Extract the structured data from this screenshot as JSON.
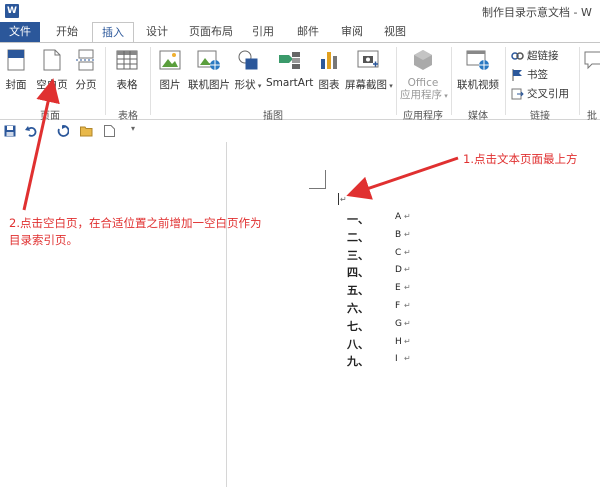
{
  "window": {
    "title": "制作目录示意文档 - W",
    "app_icon": "W"
  },
  "tabs": [
    {
      "label": "文件"
    },
    {
      "label": "开始"
    },
    {
      "label": "插入"
    },
    {
      "label": "设计"
    },
    {
      "label": "页面布局"
    },
    {
      "label": "引用"
    },
    {
      "label": "邮件"
    },
    {
      "label": "审阅"
    },
    {
      "label": "视图"
    }
  ],
  "ribbon": {
    "pages": {
      "cover": "封面",
      "blank": "空白页",
      "break": "分页",
      "group": "页面"
    },
    "tables": {
      "table": "表格",
      "group": "表格"
    },
    "illustrations": {
      "picture": "图片",
      "online_picture": "联机图片",
      "shapes": "形状",
      "smartart": "SmartArt",
      "chart": "图表",
      "screenshot": "屏幕截图",
      "group": "插图"
    },
    "apps": {
      "office_line1": "Office",
      "office_line2": "应用程序",
      "group": "应用程序"
    },
    "media": {
      "online_video": "联机视频",
      "group": "媒体"
    },
    "links": {
      "hyperlink": "超链接",
      "bookmark": "书签",
      "cross_ref": "交叉引用",
      "group": "链接"
    },
    "comments": {
      "partial": "批"
    }
  },
  "document": {
    "toc": [
      {
        "num": "一、",
        "letter": "A"
      },
      {
        "num": "二、",
        "letter": "B"
      },
      {
        "num": "三、",
        "letter": "C"
      },
      {
        "num": "四、",
        "letter": "D"
      },
      {
        "num": "五、",
        "letter": "E"
      },
      {
        "num": "六、",
        "letter": "F"
      },
      {
        "num": "七、",
        "letter": "G"
      },
      {
        "num": "八、",
        "letter": "H"
      },
      {
        "num": "九、",
        "letter": "I"
      }
    ],
    "para_mark": "↵"
  },
  "annotations": {
    "step1": "1.点击文本页面最上方",
    "step2_line1": "2.点击空白页，在合适位置之前增加一空白页作为",
    "step2_line2": "目录索引页。"
  },
  "colors": {
    "accent": "#2b579a",
    "annotation": "#e03030"
  }
}
